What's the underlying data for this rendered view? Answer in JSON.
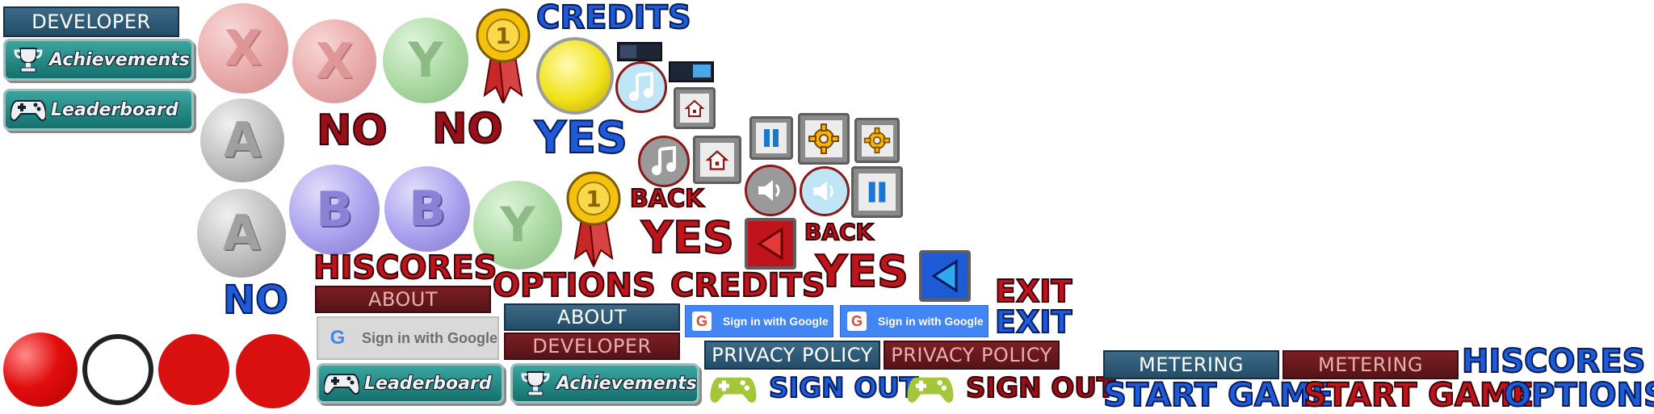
{
  "labels": {
    "developer": "DEVELOPER",
    "achievements": "Achievements",
    "leaderboard": "Leaderboard",
    "no": "NO",
    "yes": "YES",
    "credits": "CREDITS",
    "back": "BACK",
    "hiscores": "HISCORES",
    "about": "ABOUT",
    "options": "OPTIONS",
    "exit": "EXIT",
    "sign_in_google": "Sign in with Google",
    "privacy_policy": "PRIVACY POLICY",
    "sign_out": "SIGN OUT",
    "metering": "METERING",
    "start_game": "START GAME"
  },
  "glyphs": {
    "x": "X",
    "y": "Y",
    "a": "A",
    "b": "B",
    "medal": "1",
    "google": "G"
  },
  "icons": [
    "close-x-icon",
    "medal-icon",
    "music-note-icon",
    "home-icon",
    "pause-icon",
    "gear-icon",
    "speaker-icon",
    "back-arrow-icon",
    "trophy-icon",
    "gamepad-icon",
    "google-g-icon"
  ],
  "colors": {
    "blue_bar": "#234c68",
    "red_bar": "#561317",
    "teal_button": "#15706c",
    "red_text": "#c0141c",
    "blue_text": "#1e5bd6",
    "gamepad_green": "#a4c639"
  }
}
